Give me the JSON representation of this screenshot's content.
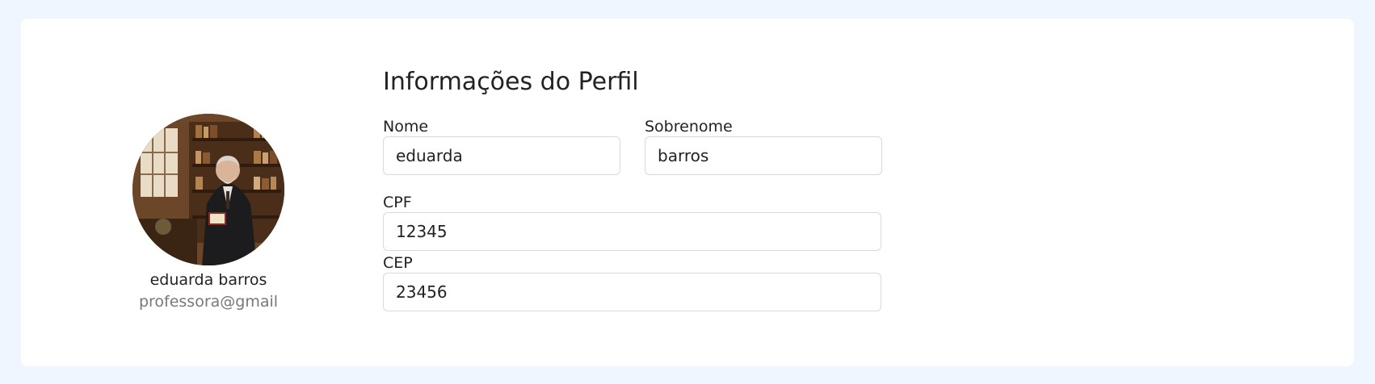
{
  "profile": {
    "name": "eduarda barros",
    "email": "professora@gmail"
  },
  "form": {
    "title": "Informações do Perfil",
    "fields": {
      "first_name": {
        "label": "Nome",
        "value": "eduarda"
      },
      "last_name": {
        "label": "Sobrenome",
        "value": "barros"
      },
      "cpf": {
        "label": "CPF",
        "value": "12345"
      },
      "cep": {
        "label": "CEP",
        "value": "23456"
      }
    }
  },
  "colors": {
    "page_background": "#eff6ff",
    "card_background": "#ffffff",
    "input_border": "#d9d9d9",
    "muted_text": "#777777"
  }
}
